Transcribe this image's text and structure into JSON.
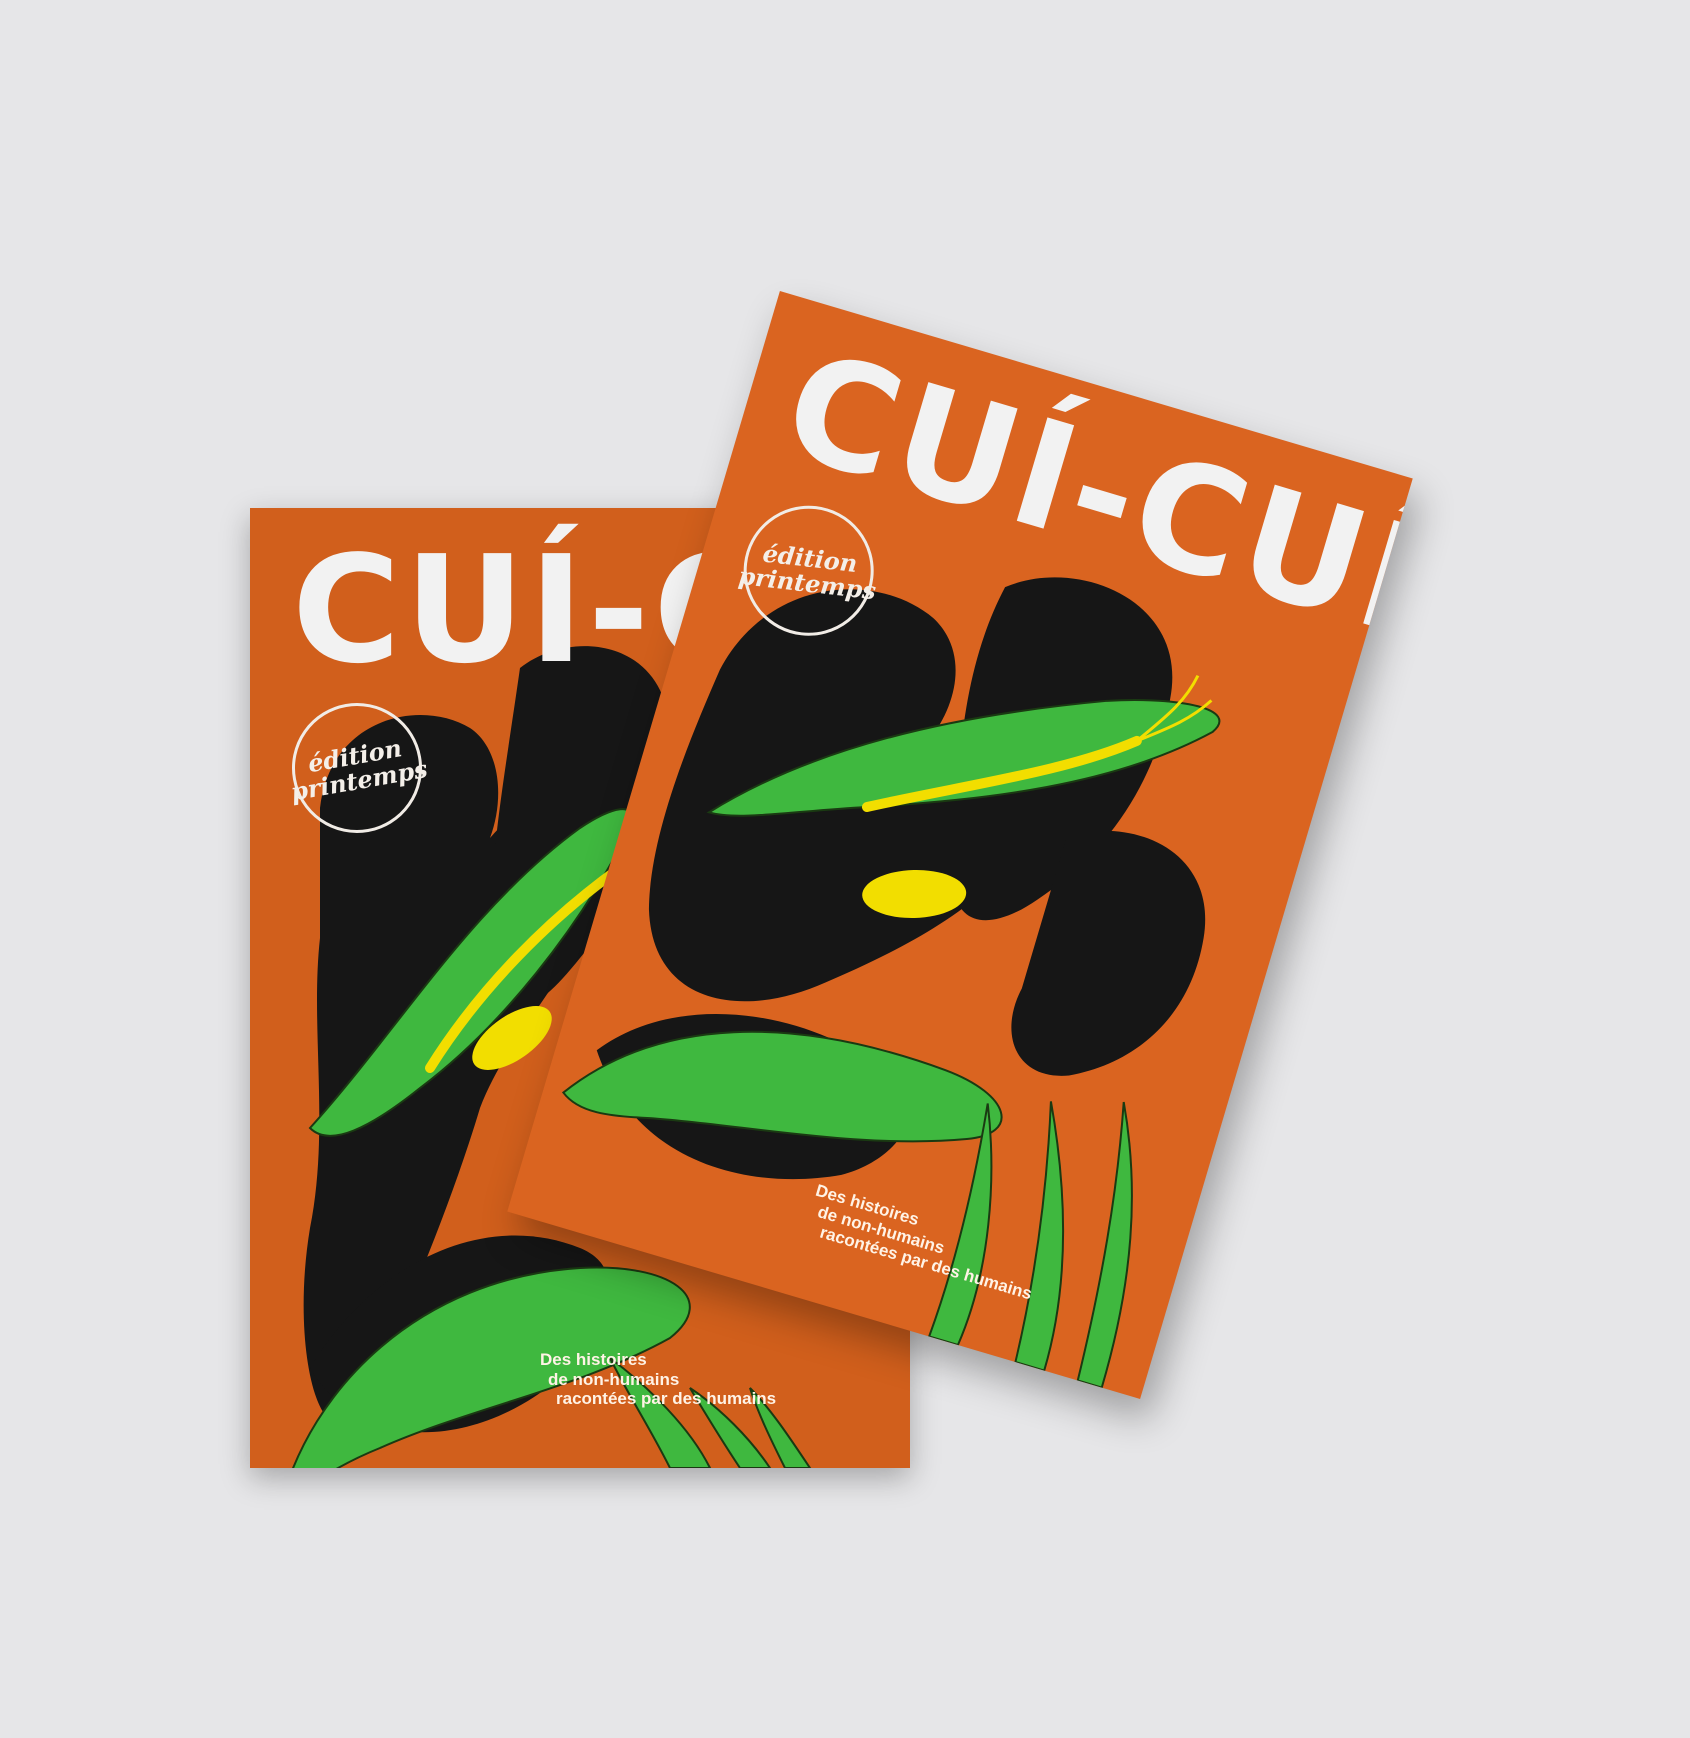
{
  "magazine": {
    "title": "CUÍ-CUÍ",
    "stamp_line1": "édition",
    "stamp_line2": "printemps",
    "tagline_line1": "Des histoires",
    "tagline_line2": "de non-humains",
    "tagline_line3": "racontées par des humains"
  },
  "colors": {
    "background": "#e6e6e8",
    "cover_orange": "#d15f1c",
    "petal_black": "#161616",
    "leaf_green": "#3fb83f",
    "stamen_yellow": "#f2de00",
    "text_white": "#f2f2f2"
  }
}
